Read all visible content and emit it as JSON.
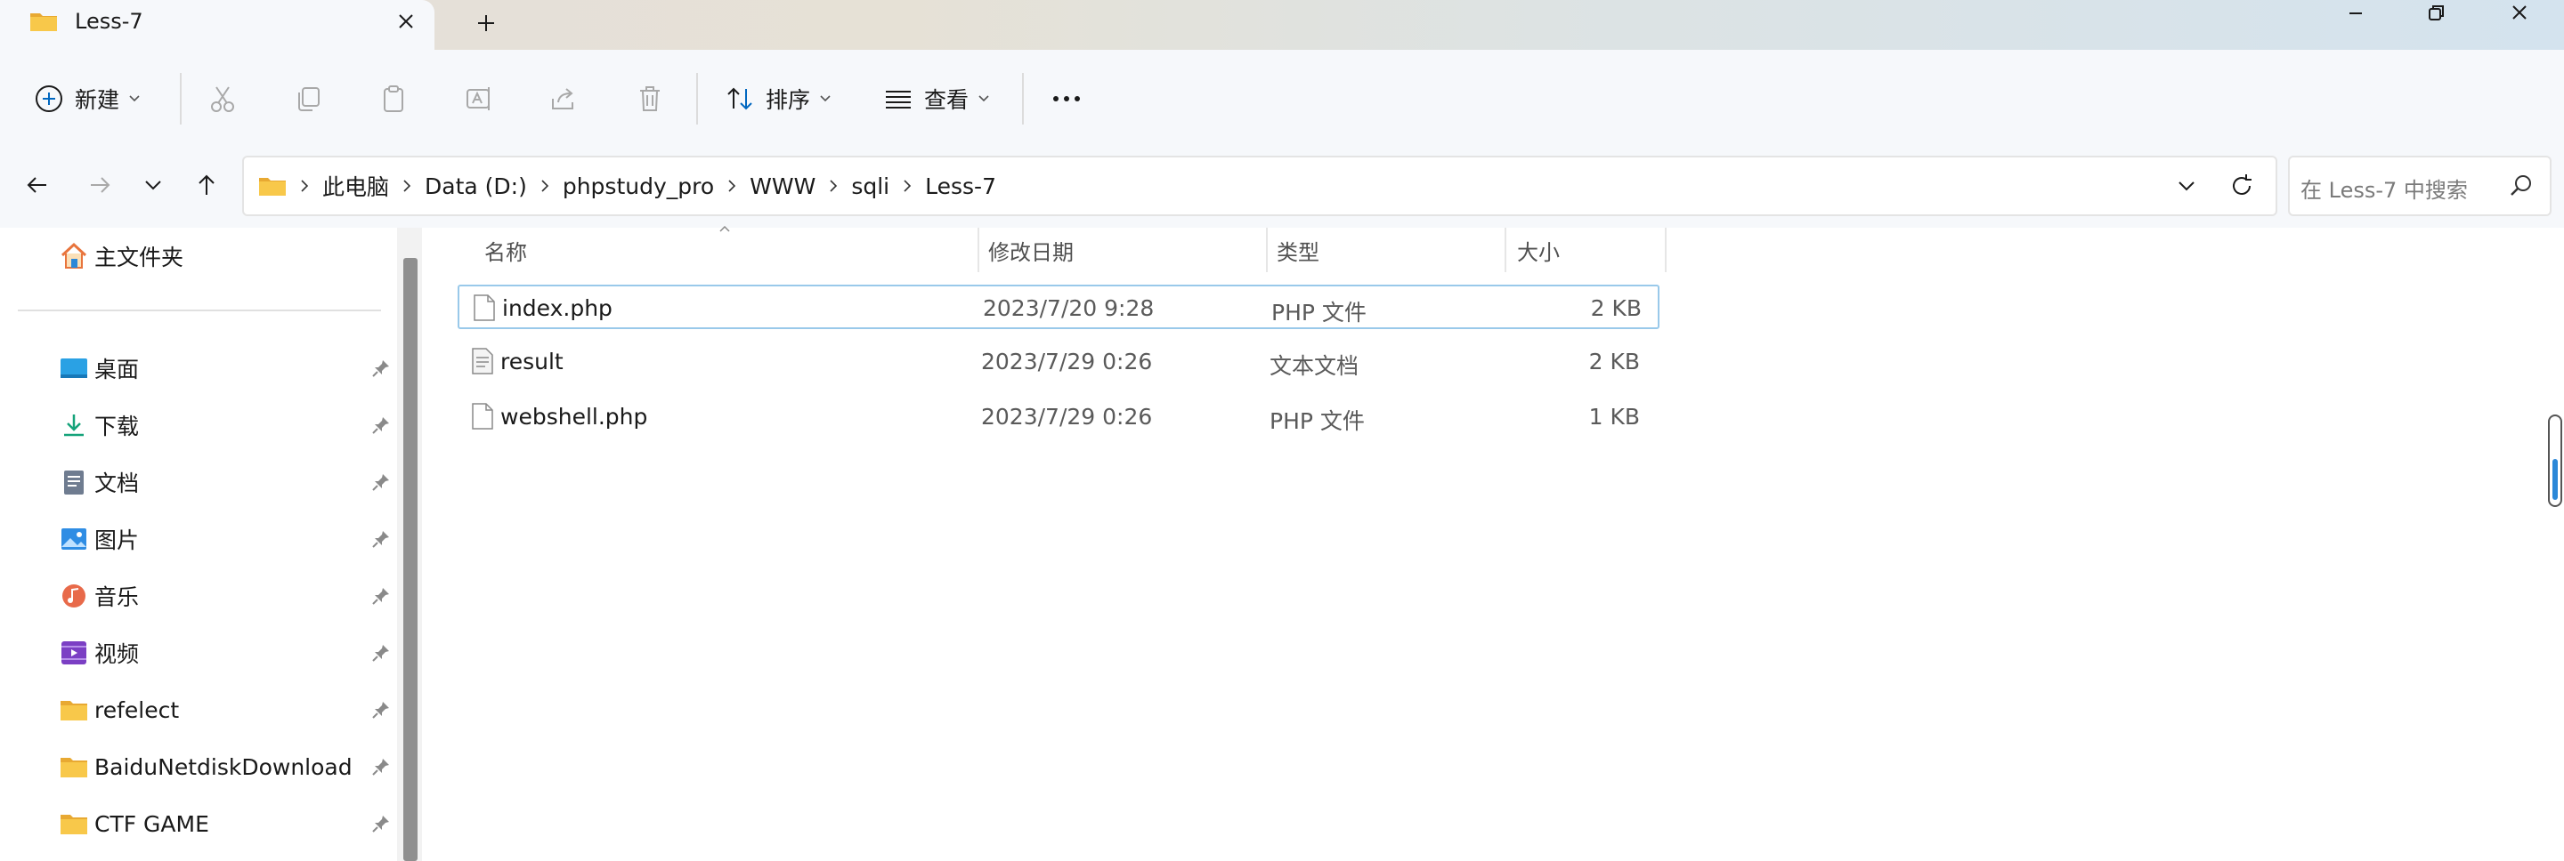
{
  "window": {
    "tab_title": "Less-7"
  },
  "toolbar": {
    "new_label": "新建",
    "sort_label": "排序",
    "view_label": "查看",
    "more_label": "···"
  },
  "address": {
    "crumbs": [
      "此电脑",
      "Data (D:)",
      "phpstudy_pro",
      "WWW",
      "sqli",
      "Less-7"
    ],
    "search_placeholder": "在 Less-7 中搜索"
  },
  "sidebar": {
    "home_label": "主文件夹",
    "items": [
      {
        "label": "桌面",
        "icon": "desktop-icon",
        "pinned": true
      },
      {
        "label": "下载",
        "icon": "download-icon",
        "pinned": true
      },
      {
        "label": "文档",
        "icon": "document-icon",
        "pinned": true
      },
      {
        "label": "图片",
        "icon": "pictures-icon",
        "pinned": true
      },
      {
        "label": "音乐",
        "icon": "music-icon",
        "pinned": true
      },
      {
        "label": "视频",
        "icon": "video-icon",
        "pinned": true
      },
      {
        "label": "refelect",
        "icon": "folder-icon",
        "pinned": true
      },
      {
        "label": "BaiduNetdiskDownload",
        "icon": "folder-icon",
        "pinned": true
      },
      {
        "label": "CTF GAME",
        "icon": "folder-icon",
        "pinned": true
      }
    ]
  },
  "columns": {
    "name": "名称",
    "modified": "修改日期",
    "type": "类型",
    "size": "大小"
  },
  "files": [
    {
      "name": "index.php",
      "modified": "2023/7/20 9:28",
      "type": "PHP 文件",
      "size": "2 KB",
      "selected": true
    },
    {
      "name": "result",
      "modified": "2023/7/29 0:26",
      "type": "文本文档",
      "size": "2 KB",
      "selected": false
    },
    {
      "name": "webshell.php",
      "modified": "2023/7/29 0:26",
      "type": "PHP 文件",
      "size": "1 KB",
      "selected": false
    }
  ],
  "colors": {
    "accent": "#0067c0",
    "folder": "#f8c84a",
    "selection_border": "#99c9ea"
  }
}
